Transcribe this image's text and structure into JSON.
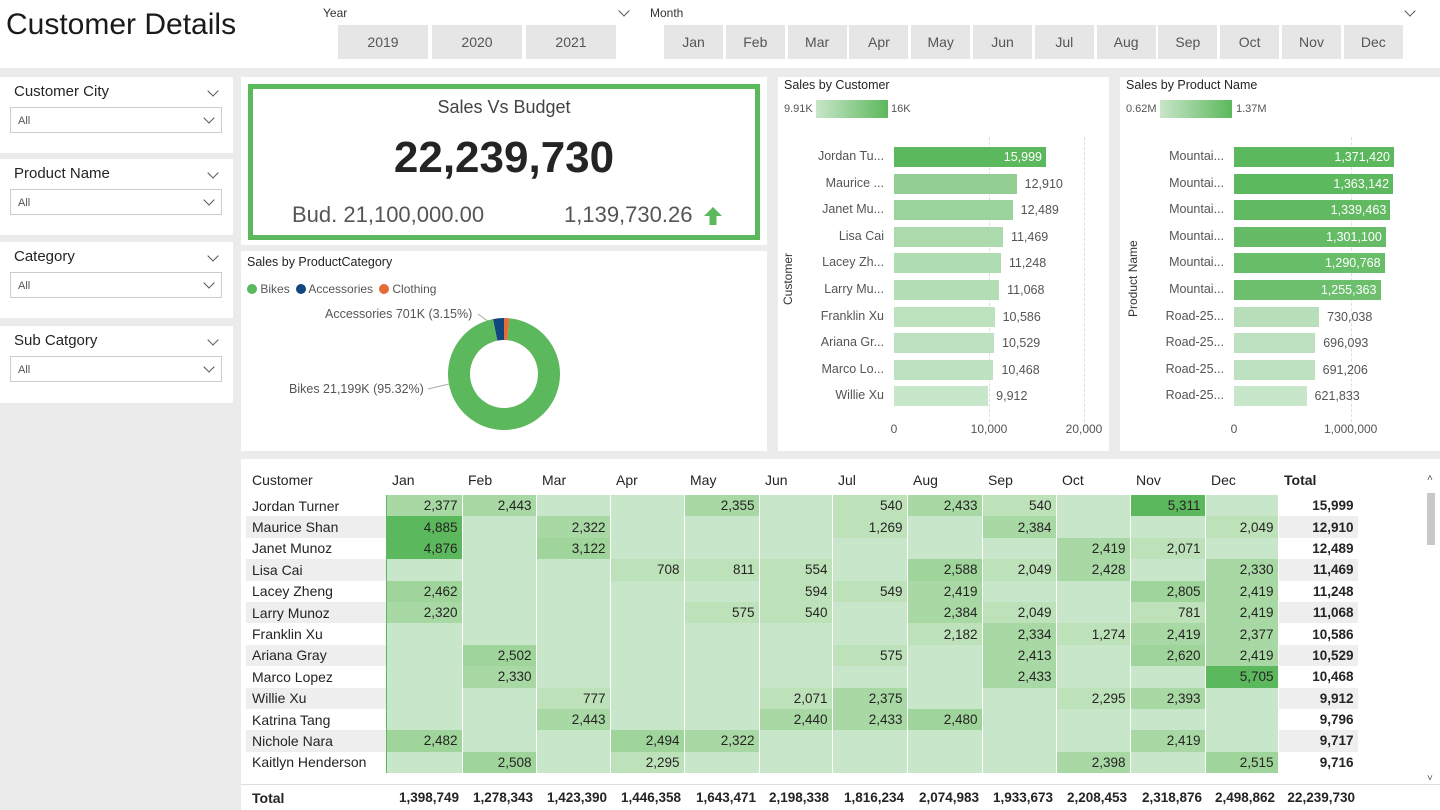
{
  "page": {
    "title": "Customer Details"
  },
  "slicers": {
    "year": {
      "label": "Year",
      "options": [
        "2019",
        "2020",
        "2021"
      ]
    },
    "month": {
      "label": "Month",
      "options": [
        "Jan",
        "Feb",
        "Mar",
        "Apr",
        "May",
        "Jun",
        "Jul",
        "Aug",
        "Sep",
        "Oct",
        "Nov",
        "Dec"
      ]
    }
  },
  "filters": [
    {
      "title": "Customer City",
      "value": "All"
    },
    {
      "title": "Product Name",
      "value": "All"
    },
    {
      "title": "Category",
      "value": "All"
    },
    {
      "title": "Sub Catgory",
      "value": "All"
    }
  ],
  "kpi": {
    "title": "Sales Vs Budget",
    "value": "22,239,730",
    "budget": "Bud. 21,100,000.00",
    "variance": "1,139,730.26",
    "accent": "#5cb85c"
  },
  "donut": {
    "title": "Sales by ProductCategory",
    "legend": [
      {
        "name": "Bikes",
        "color": "#5cb85c"
      },
      {
        "name": "Accessories",
        "color": "#12467f"
      },
      {
        "name": "Clothing",
        "color": "#e66c37"
      }
    ],
    "label_accessories": "Accessories 701K (3.15%)",
    "label_bikes": "Bikes 21,199K (95.32%)"
  },
  "sales_by_customer": {
    "title": "Sales by Customer",
    "axis_title": "Customer",
    "scale_min": "9.91K",
    "scale_max": "16K",
    "ticks": [
      "0",
      "10,000",
      "20,000"
    ]
  },
  "sales_by_product": {
    "title": "Sales by Product Name",
    "axis_title": "Product Name",
    "scale_min": "0.62M",
    "scale_max": "1.37M",
    "ticks": [
      "0",
      "1,000,000"
    ]
  },
  "chart_data": [
    {
      "type": "pie",
      "title": "Sales by ProductCategory",
      "categories": [
        "Bikes",
        "Accessories",
        "Clothing"
      ],
      "values": [
        21199,
        701,
        340
      ],
      "percent": [
        95.32,
        3.15,
        1.53
      ]
    },
    {
      "type": "bar",
      "orientation": "horizontal",
      "title": "Sales by Customer",
      "ylabel": "Customer",
      "categories": [
        "Jordan Tu...",
        "Maurice ...",
        "Janet Mu...",
        "Lisa Cai",
        "Lacey Zh...",
        "Larry Mu...",
        "Franklin Xu",
        "Ariana Gr...",
        "Marco Lo...",
        "Willie Xu"
      ],
      "values": [
        15999,
        12910,
        12489,
        11469,
        11248,
        11068,
        10586,
        10529,
        10468,
        9912
      ],
      "labels": [
        "15,999",
        "12,910",
        "12,489",
        "11,469",
        "11,248",
        "11,068",
        "10,586",
        "10,529",
        "10,468",
        "9,912"
      ],
      "xlim": [
        0,
        20000
      ]
    },
    {
      "type": "bar",
      "orientation": "horizontal",
      "title": "Sales by Product Name",
      "ylabel": "Product Name",
      "categories": [
        "Mountai...",
        "Mountai...",
        "Mountai...",
        "Mountai...",
        "Mountai...",
        "Mountai...",
        "Road-25...",
        "Road-25...",
        "Road-25...",
        "Road-25..."
      ],
      "values": [
        1371420,
        1363142,
        1339463,
        1301100,
        1290768,
        1255363,
        730038,
        696093,
        691206,
        621833
      ],
      "labels": [
        "1,371,420",
        "1,363,142",
        "1,339,463",
        "1,301,100",
        "1,290,768",
        "1,255,363",
        "730,038",
        "696,093",
        "691,206",
        "621,833"
      ],
      "xlim": [
        0,
        1500000
      ]
    }
  ],
  "matrix": {
    "columns": [
      "Customer",
      "Jan",
      "Feb",
      "Mar",
      "Apr",
      "May",
      "Jun",
      "Jul",
      "Aug",
      "Sep",
      "Oct",
      "Nov",
      "Dec",
      "Total"
    ],
    "rows": [
      [
        "Jordan Turner",
        "2,377",
        "2,443",
        "",
        "",
        "2,355",
        "",
        "540",
        "2,433",
        "540",
        "",
        "5,311",
        "",
        "15,999"
      ],
      [
        "Maurice Shan",
        "4,885",
        "",
        "2,322",
        "",
        "",
        "",
        "1,269",
        "",
        "2,384",
        "",
        "",
        "2,049",
        "12,910"
      ],
      [
        "Janet Munoz",
        "4,876",
        "",
        "3,122",
        "",
        "",
        "",
        "",
        "",
        "",
        "2,419",
        "2,071",
        "",
        "12,489"
      ],
      [
        "Lisa Cai",
        "",
        "",
        "",
        "708",
        "811",
        "554",
        "",
        "2,588",
        "2,049",
        "2,428",
        "",
        "2,330",
        "11,469"
      ],
      [
        "Lacey Zheng",
        "2,462",
        "",
        "",
        "",
        "",
        "594",
        "549",
        "2,419",
        "",
        "",
        "2,805",
        "2,419",
        "11,248"
      ],
      [
        "Larry Munoz",
        "2,320",
        "",
        "",
        "",
        "575",
        "540",
        "",
        "2,384",
        "2,049",
        "",
        "781",
        "2,419",
        "11,068"
      ],
      [
        "Franklin Xu",
        "",
        "",
        "",
        "",
        "",
        "",
        "",
        "2,182",
        "2,334",
        "1,274",
        "2,419",
        "2,377",
        "10,586"
      ],
      [
        "Ariana Gray",
        "",
        "2,502",
        "",
        "",
        "",
        "",
        "575",
        "",
        "2,413",
        "",
        "2,620",
        "2,419",
        "10,529"
      ],
      [
        "Marco Lopez",
        "",
        "2,330",
        "",
        "",
        "",
        "",
        "",
        "",
        "2,433",
        "",
        "",
        "5,705",
        "10,468"
      ],
      [
        "Willie Xu",
        "",
        "",
        "777",
        "",
        "",
        "2,071",
        "2,375",
        "",
        "",
        "2,295",
        "2,393",
        "",
        "9,912"
      ],
      [
        "Katrina Tang",
        "",
        "",
        "2,443",
        "",
        "",
        "2,440",
        "2,433",
        "2,480",
        "",
        "",
        "",
        "",
        "9,796"
      ],
      [
        "Nichole Nara",
        "2,482",
        "",
        "",
        "2,494",
        "2,322",
        "",
        "",
        "",
        "",
        "",
        "2,419",
        "",
        "9,717"
      ],
      [
        "Kaitlyn Henderson",
        "",
        "2,508",
        "",
        "2,295",
        "",
        "",
        "",
        "",
        "",
        "2,398",
        "",
        "2,515",
        "9,716"
      ]
    ],
    "total_row": [
      "Total",
      "1,398,749",
      "1,278,343",
      "1,423,390",
      "1,446,358",
      "1,643,471",
      "2,198,338",
      "1,816,234",
      "2,074,983",
      "1,933,673",
      "2,208,453",
      "2,318,876",
      "2,498,862",
      "22,239,730"
    ]
  }
}
